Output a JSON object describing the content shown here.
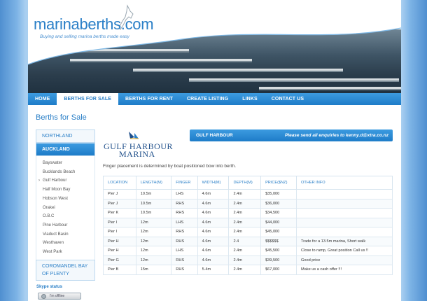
{
  "site": {
    "logo_text": "marinaberths.com",
    "tagline": "Buying and selling marina berths made easy"
  },
  "nav": {
    "items": [
      {
        "label": "HOME"
      },
      {
        "label": "BERTHS FOR SALE",
        "active": true
      },
      {
        "label": "BERTHS FOR RENT"
      },
      {
        "label": "CREATE LISTING"
      },
      {
        "label": "LINKS"
      },
      {
        "label": "CONTACT US"
      }
    ]
  },
  "page_heading": "Berths for Sale",
  "sidebar": {
    "group_northland": "NORTHLAND",
    "group_auckland": "AUCKLAND",
    "auckland_items": [
      "Bayswater",
      "Bucklands Beach",
      "Gulf Harbour",
      "Half Moon Bay",
      "Hobson West",
      "Orakei",
      "O.B.C",
      "Pine Harbour",
      "Viaduct Basin",
      "Westhaven",
      "West Park"
    ],
    "group_coromandel_line1": "COROMANDEL BAY",
    "group_coromandel_line2": "OF PLENTY",
    "skype_label": "Skype status",
    "skype_status": "I'm offline"
  },
  "marina": {
    "logo_line1": "GULF HARBOUR",
    "logo_line2": "MARINA",
    "intro": "Finger placement is determined by boat positioned bow into berth.",
    "bar_name": "GULF HARBOUR",
    "bar_enquiries": "Please send all enquiries to kenny.d@xtra.co.nz"
  },
  "table": {
    "headers": [
      "LOCATION",
      "LENGTH(M)",
      "FINGER",
      "WIDTH(M)",
      "DEPTH(M)",
      "PRICE($NZ)",
      "OTHER INFO"
    ],
    "rows": [
      [
        "Pier J",
        "10.5m",
        "LHS",
        "4.6m",
        "2.4m",
        "$35,000",
        ""
      ],
      [
        "Pier J",
        "10.5m",
        "RHS",
        "4.6m",
        "2.4m",
        "$36,000",
        ""
      ],
      [
        "Pier K",
        "10.5m",
        "RHS",
        "4.6m",
        "2.4m",
        "$34,500",
        ""
      ],
      [
        "Pier I",
        "12m",
        "LHS",
        "4.6m",
        "2.4m",
        "$44,000",
        ""
      ],
      [
        "Pier I",
        "12m",
        "RHS",
        "4.6m",
        "2.4m",
        "$45,000",
        ""
      ],
      [
        "Pier H",
        "12m",
        "RHS",
        "4.6m",
        "2.4",
        "$$$$$$",
        "Trade for a 13.5m marina, Short walk"
      ],
      [
        "Pier H",
        "12m",
        "LHS",
        "4.6m",
        "2.4m",
        "$45,500",
        "Close to ramp, Great position Call us !!"
      ],
      [
        "Pier G",
        "12m",
        "RHS",
        "4.6m",
        "2.4m",
        "$39,500",
        "Good price"
      ],
      [
        "Pier B",
        "15m",
        "RHS",
        "5.4m",
        "2.4m",
        "$67,000",
        "Make us a cash offer !!!"
      ]
    ]
  },
  "colors": {
    "accent": "#2a7fc7",
    "nav_gradient_top": "#3c9be0",
    "nav_gradient_bottom": "#1e7cc8",
    "background_side": "#a9cff0"
  }
}
